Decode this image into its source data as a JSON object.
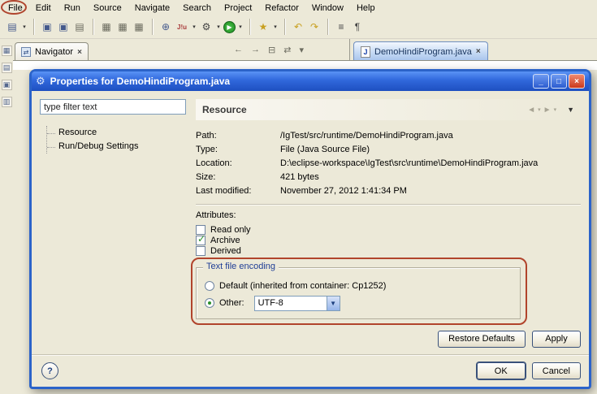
{
  "menu": {
    "items": [
      "File",
      "Edit",
      "Run",
      "Source",
      "Navigate",
      "Search",
      "Project",
      "Refactor",
      "Window",
      "Help"
    ]
  },
  "toolbar": {
    "caret": "▾",
    "icons": {
      "new": "▤",
      "save": "▣",
      "save_all": "▣",
      "print": "▤",
      "g1": "▦",
      "g2": "▦",
      "g3": "▦",
      "new_class": "⊕",
      "junit": "J!u",
      "debug": "⚙",
      "run": "▶",
      "search": "★",
      "prev_edit": "↶",
      "next_edit": "↷",
      "format": "≡",
      "whitespace": "¶"
    }
  },
  "rail": {
    "icons": [
      "▦",
      "▤",
      "▣",
      "▥"
    ]
  },
  "navigator": {
    "tab": "Navigator",
    "close": "×",
    "view_icons": [
      "←",
      "→",
      "⊟",
      "⇄",
      "▾"
    ]
  },
  "editor": {
    "tab": "DemoHindiProgram.java",
    "close": "×",
    "file_icon": "J"
  },
  "dialog": {
    "title": "Properties for DemoHindiProgram.java",
    "window_buttons": {
      "minimize": "_",
      "maximize": "□",
      "close": "×"
    },
    "filter_text": "type filter text",
    "tree": [
      "Resource",
      "Run/Debug Settings"
    ],
    "header": {
      "title": "Resource",
      "back": "◄",
      "forward": "►",
      "caret": "▾",
      "menu": "▼"
    },
    "fields": [
      {
        "label": "Path:",
        "value": "/IgTest/src/runtime/DemoHindiProgram.java"
      },
      {
        "label": "Type:",
        "value": "File  (Java Source File)"
      },
      {
        "label": "Location:",
        "value": "D:\\eclipse-workspace\\IgTest\\src\\runtime\\DemoHindiProgram.java"
      },
      {
        "label": "Size:",
        "value": "421 bytes"
      },
      {
        "label": "Last modified:",
        "value": "November 27, 2012 1:41:34 PM"
      }
    ],
    "attributes": {
      "label": "Attributes:",
      "items": [
        {
          "label": "Read only",
          "checked": false
        },
        {
          "label": "Archive",
          "checked": true
        },
        {
          "label": "Derived",
          "checked": false
        }
      ]
    },
    "encoding": {
      "group": "Text file encoding",
      "default_option": {
        "label": "Default (inherited from container: Cp1252)",
        "selected": false
      },
      "other_option": {
        "label": "Other:",
        "selected": true
      },
      "other_value": "UTF-8",
      "combo_arrow": "▼"
    },
    "buttons": {
      "restore": "Restore Defaults",
      "apply": "Apply",
      "ok": "OK",
      "cancel": "Cancel",
      "help": "?"
    }
  }
}
